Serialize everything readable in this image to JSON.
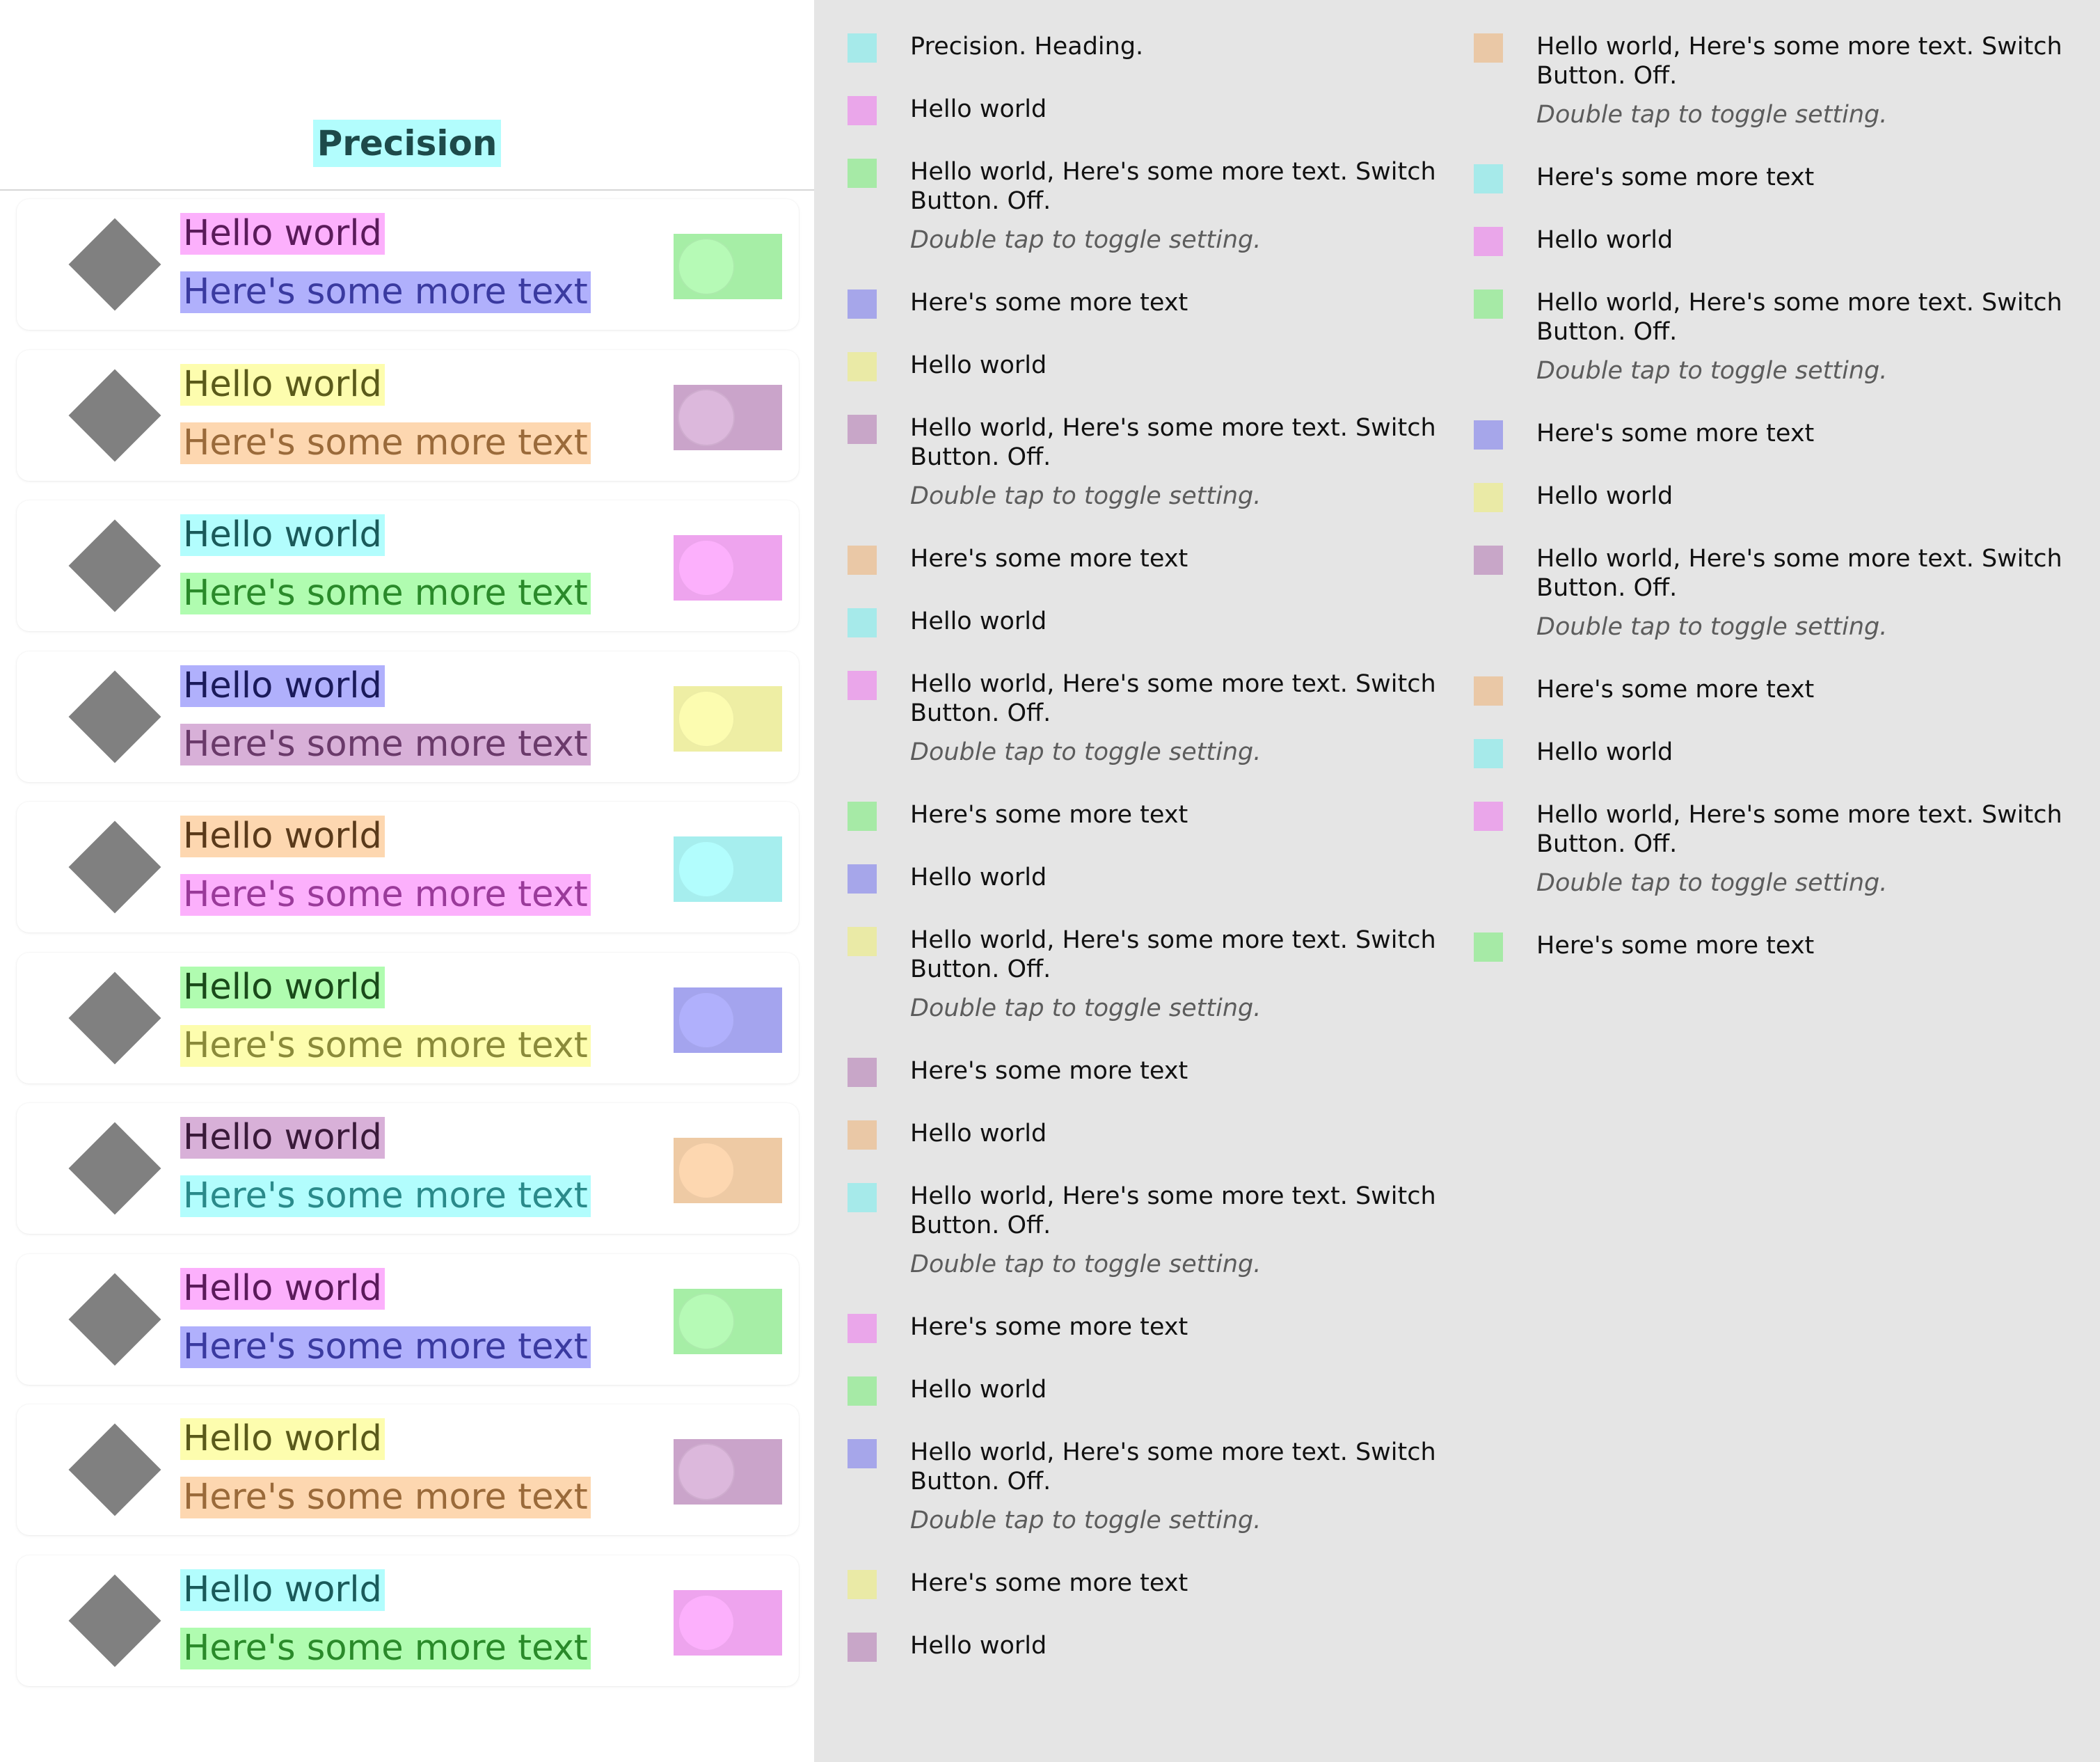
{
  "nav": {
    "title": "Precision",
    "title_color": "#b2fdfd"
  },
  "rows": [
    {
      "title": "Hello world",
      "subtitle": "Here's some more text",
      "title_bg": "#fcb0fc",
      "title_fg": "#5a1a5a",
      "subtitle_bg": "#b0b0fc",
      "subtitle_fg": "#3a3aa0",
      "toggle_bg": "#a6eea6",
      "knob": "#b6fab6"
    },
    {
      "title": "Hello world",
      "subtitle": "Here's some more text",
      "title_bg": "#fdfdae",
      "title_fg": "#5a5a1a",
      "subtitle_bg": "#fdd7b0",
      "subtitle_fg": "#9a6a3a",
      "toggle_bg": "#caa4ca",
      "knob": "#dcb8dc"
    },
    {
      "title": "Hello world",
      "subtitle": "Here's some more text",
      "title_bg": "#b2fdfd",
      "title_fg": "#1a5a5a",
      "subtitle_bg": "#b0fcb0",
      "subtitle_fg": "#2a8a2a",
      "toggle_bg": "#eea4ee",
      "knob": "#fcb0fc"
    },
    {
      "title": "Hello world",
      "subtitle": "Here's some more text",
      "title_bg": "#b0b0fc",
      "title_fg": "#1a1a5a",
      "subtitle_bg": "#d8b0d8",
      "subtitle_fg": "#6a3a6a",
      "toggle_bg": "#eeeea4",
      "knob": "#fcfcb0"
    },
    {
      "title": "Hello world",
      "subtitle": "Here's some more text",
      "title_bg": "#fdd7b0",
      "title_fg": "#5a3a1a",
      "subtitle_bg": "#fcb0fc",
      "subtitle_fg": "#9a3a9a",
      "toggle_bg": "#a6eeee",
      "knob": "#b2fdfd"
    },
    {
      "title": "Hello world",
      "subtitle": "Here's some more text",
      "title_bg": "#b0fcb0",
      "title_fg": "#1a4a1a",
      "subtitle_bg": "#fdfdae",
      "subtitle_fg": "#8a8a3a",
      "toggle_bg": "#a4a4ee",
      "knob": "#b0b0fc"
    },
    {
      "title": "Hello world",
      "subtitle": "Here's some more text",
      "title_bg": "#d8b0d8",
      "title_fg": "#3a1a3a",
      "subtitle_bg": "#b2fdfd",
      "subtitle_fg": "#2a8a8a",
      "toggle_bg": "#eecaa4",
      "knob": "#fdd7b0"
    },
    {
      "title": "Hello world",
      "subtitle": "Here's some more text",
      "title_bg": "#fcb0fc",
      "title_fg": "#5a1a5a",
      "subtitle_bg": "#b0b0fc",
      "subtitle_fg": "#3a3aa0",
      "toggle_bg": "#a6eea6",
      "knob": "#b6fab6"
    },
    {
      "title": "Hello world",
      "subtitle": "Here's some more text",
      "title_bg": "#fdfdae",
      "title_fg": "#5a5a1a",
      "subtitle_bg": "#fdd7b0",
      "subtitle_fg": "#9a6a3a",
      "toggle_bg": "#caa4ca",
      "knob": "#dcb8dc"
    },
    {
      "title": "Hello world",
      "subtitle": "Here's some more text",
      "title_bg": "#b2fdfd",
      "title_fg": "#1a5a5a",
      "subtitle_bg": "#b0fcb0",
      "subtitle_fg": "#2a8a2a",
      "toggle_bg": "#eea4ee",
      "knob": "#fcb0fc"
    }
  ],
  "accessibility": {
    "column1": [
      {
        "label": "Precision. Heading.",
        "hint": "",
        "color": "#a6eaea"
      },
      {
        "label": "Hello world",
        "hint": "",
        "color": "#eaa6ea"
      },
      {
        "label": "Hello world, Here's some more text. Switch Button. Off.",
        "hint": "Double tap to toggle setting.",
        "color": "#a6eaa6"
      },
      {
        "label": "Here's some more text",
        "hint": "",
        "color": "#a6a6ea"
      },
      {
        "label": "Hello world",
        "hint": "",
        "color": "#eaeaa6"
      },
      {
        "label": "Hello world, Here's some more text. Switch Button. Off.",
        "hint": "Double tap to toggle setting.",
        "color": "#c8a6c8"
      },
      {
        "label": "Here's some more text",
        "hint": "",
        "color": "#eac8a6"
      },
      {
        "label": "Hello world",
        "hint": "",
        "color": "#a6eaea"
      },
      {
        "label": "Hello world, Here's some more text. Switch Button. Off.",
        "hint": "Double tap to toggle setting.",
        "color": "#eaa6ea"
      },
      {
        "label": "Here's some more text",
        "hint": "",
        "color": "#a6eaa6"
      },
      {
        "label": "Hello world",
        "hint": "",
        "color": "#a6a6ea"
      },
      {
        "label": "Hello world, Here's some more text. Switch Button. Off.",
        "hint": "Double tap to toggle setting.",
        "color": "#eaeaa6"
      },
      {
        "label": "Here's some more text",
        "hint": "",
        "color": "#c8a6c8"
      },
      {
        "label": "Hello world",
        "hint": "",
        "color": "#eac8a6"
      },
      {
        "label": "Hello world, Here's some more text. Switch Button. Off.",
        "hint": "Double tap to toggle setting.",
        "color": "#a6eaea"
      },
      {
        "label": "Here's some more text",
        "hint": "",
        "color": "#eaa6ea"
      },
      {
        "label": "Hello world",
        "hint": "",
        "color": "#a6eaa6"
      },
      {
        "label": "Hello world, Here's some more text. Switch Button. Off.",
        "hint": "Double tap to toggle setting.",
        "color": "#a6a6ea"
      },
      {
        "label": "Here's some more text",
        "hint": "",
        "color": "#eaeaa6"
      },
      {
        "label": "Hello world",
        "hint": "",
        "color": "#c8a6c8"
      }
    ],
    "column2": [
      {
        "label": "Hello world, Here's some more text. Switch Button. Off.",
        "hint": "Double tap to toggle setting.",
        "color": "#eac8a6"
      },
      {
        "label": "Here's some more text",
        "hint": "",
        "color": "#a6eaea"
      },
      {
        "label": "Hello world",
        "hint": "",
        "color": "#eaa6ea"
      },
      {
        "label": "Hello world, Here's some more text. Switch Button. Off.",
        "hint": "Double tap to toggle setting.",
        "color": "#a6eaa6"
      },
      {
        "label": "Here's some more text",
        "hint": "",
        "color": "#a6a6ea"
      },
      {
        "label": "Hello world",
        "hint": "",
        "color": "#eaeaa6"
      },
      {
        "label": "Hello world, Here's some more text. Switch Button. Off.",
        "hint": "Double tap to toggle setting.",
        "color": "#c8a6c8"
      },
      {
        "label": "Here's some more text",
        "hint": "",
        "color": "#eac8a6"
      },
      {
        "label": "Hello world",
        "hint": "",
        "color": "#a6eaea"
      },
      {
        "label": "Hello world, Here's some more text. Switch Button. Off.",
        "hint": "Double tap to toggle setting.",
        "color": "#eaa6ea"
      },
      {
        "label": "Here's some more text",
        "hint": "",
        "color": "#a6eaa6"
      }
    ]
  }
}
